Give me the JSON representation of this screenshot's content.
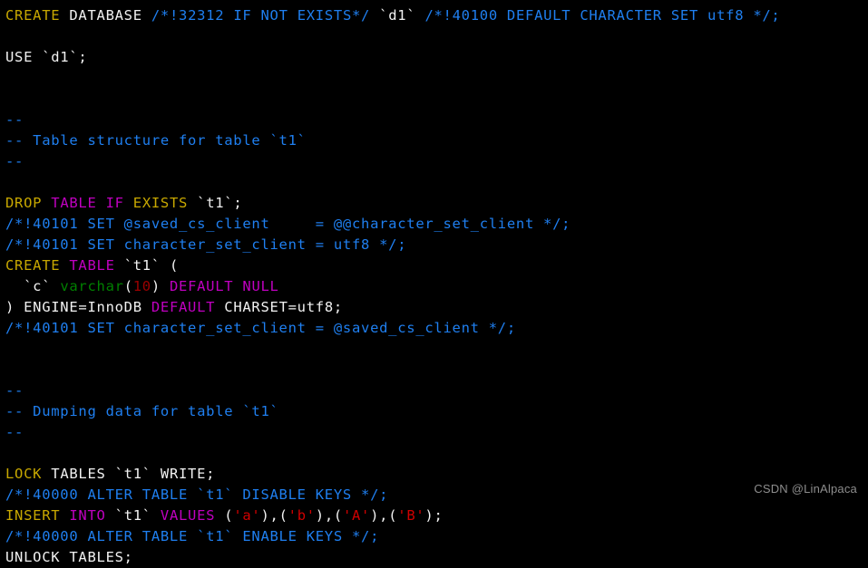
{
  "document": {
    "background_color": "#000000",
    "colors": {
      "keyword_yellow": "#c8a800",
      "keyword_magenta": "#c000c0",
      "plain_text": "#f2f2f2",
      "comment_blue": "#1f7ff0",
      "type_green": "#008000",
      "number_red": "#9c0000",
      "string_red": "#d00000",
      "watermark_gray": "#8d8d8d"
    },
    "lines": [
      {
        "index": 1,
        "text": "CREATE DATABASE /*!32312 IF NOT EXISTS*/ `d1` /*!40100 DEFAULT CHARACTER SET utf8 */;",
        "tokens": [
          {
            "t": "CREATE",
            "c": "kw"
          },
          {
            "t": " ",
            "c": "plain"
          },
          {
            "t": "DATABASE",
            "c": "plain"
          },
          {
            "t": " ",
            "c": "plain"
          },
          {
            "t": "/*!32312 IF NOT EXISTS*/",
            "c": "cmt"
          },
          {
            "t": " ",
            "c": "plain"
          },
          {
            "t": "`d1`",
            "c": "plain"
          },
          {
            "t": " ",
            "c": "plain"
          },
          {
            "t": "/*!40100 DEFAULT CHARACTER SET utf8 */;",
            "c": "cmt"
          }
        ]
      },
      {
        "index": 2,
        "text": "",
        "tokens": []
      },
      {
        "index": 3,
        "text": "USE `d1`;",
        "tokens": [
          {
            "t": "USE `d1`;",
            "c": "plain"
          }
        ]
      },
      {
        "index": 4,
        "text": "",
        "tokens": []
      },
      {
        "index": 5,
        "text": "",
        "tokens": []
      },
      {
        "index": 6,
        "text": "--",
        "tokens": [
          {
            "t": "--",
            "c": "cmt"
          }
        ]
      },
      {
        "index": 7,
        "text": "-- Table structure for table `t1`",
        "tokens": [
          {
            "t": "-- Table structure for table `t1`",
            "c": "cmt"
          }
        ]
      },
      {
        "index": 8,
        "text": "--",
        "tokens": [
          {
            "t": "--",
            "c": "cmt"
          }
        ]
      },
      {
        "index": 9,
        "text": "",
        "tokens": []
      },
      {
        "index": 10,
        "text": "DROP TABLE IF EXISTS `t1`;",
        "tokens": [
          {
            "t": "DROP",
            "c": "kw"
          },
          {
            "t": " ",
            "c": "plain"
          },
          {
            "t": "TABLE",
            "c": "kw2"
          },
          {
            "t": " ",
            "c": "plain"
          },
          {
            "t": "IF",
            "c": "kw2"
          },
          {
            "t": " ",
            "c": "plain"
          },
          {
            "t": "EXISTS",
            "c": "kw"
          },
          {
            "t": " ",
            "c": "plain"
          },
          {
            "t": "`t1`;",
            "c": "plain"
          }
        ]
      },
      {
        "index": 11,
        "text": "/*!40101 SET @saved_cs_client     = @@character_set_client */;",
        "tokens": [
          {
            "t": "/*!40101 SET @saved_cs_client     = @@character_set_client */;",
            "c": "cmt"
          }
        ]
      },
      {
        "index": 12,
        "text": "/*!40101 SET character_set_client = utf8 */;",
        "tokens": [
          {
            "t": "/*!40101 SET character_set_client = utf8 */;",
            "c": "cmt"
          }
        ]
      },
      {
        "index": 13,
        "text": "CREATE TABLE `t1` (",
        "tokens": [
          {
            "t": "CREATE",
            "c": "kw"
          },
          {
            "t": " ",
            "c": "plain"
          },
          {
            "t": "TABLE",
            "c": "kw2"
          },
          {
            "t": " ",
            "c": "plain"
          },
          {
            "t": "`t1` (",
            "c": "plain"
          }
        ]
      },
      {
        "index": 14,
        "text": "  `c` varchar(10) DEFAULT NULL",
        "tokens": [
          {
            "t": "  `c` ",
            "c": "plain"
          },
          {
            "t": "varchar",
            "c": "type"
          },
          {
            "t": "(",
            "c": "plain"
          },
          {
            "t": "10",
            "c": "num"
          },
          {
            "t": ") ",
            "c": "plain"
          },
          {
            "t": "DEFAULT",
            "c": "kw2"
          },
          {
            "t": " ",
            "c": "plain"
          },
          {
            "t": "NULL",
            "c": "kw2"
          }
        ]
      },
      {
        "index": 15,
        "text": ") ENGINE=InnoDB DEFAULT CHARSET=utf8;",
        "tokens": [
          {
            "t": ") ENGINE=InnoDB ",
            "c": "plain"
          },
          {
            "t": "DEFAULT",
            "c": "kw2"
          },
          {
            "t": " CHARSET=utf8;",
            "c": "plain"
          }
        ]
      },
      {
        "index": 16,
        "text": "/*!40101 SET character_set_client = @saved_cs_client */;",
        "tokens": [
          {
            "t": "/*!40101 SET character_set_client = @saved_cs_client */;",
            "c": "cmt"
          }
        ]
      },
      {
        "index": 17,
        "text": "",
        "tokens": []
      },
      {
        "index": 18,
        "text": "",
        "tokens": []
      },
      {
        "index": 19,
        "text": "--",
        "tokens": [
          {
            "t": "--",
            "c": "cmt"
          }
        ]
      },
      {
        "index": 20,
        "text": "-- Dumping data for table `t1`",
        "tokens": [
          {
            "t": "-- Dumping data for table `t1`",
            "c": "cmt"
          }
        ]
      },
      {
        "index": 21,
        "text": "--",
        "tokens": [
          {
            "t": "--",
            "c": "cmt"
          }
        ]
      },
      {
        "index": 22,
        "text": "",
        "tokens": []
      },
      {
        "index": 23,
        "text": "LOCK TABLES `t1` WRITE;",
        "tokens": [
          {
            "t": "LOCK",
            "c": "kw"
          },
          {
            "t": " TABLES `t1` WRITE;",
            "c": "plain"
          }
        ]
      },
      {
        "index": 24,
        "text": "/*!40000 ALTER TABLE `t1` DISABLE KEYS */;",
        "tokens": [
          {
            "t": "/*!40000 ALTER TABLE `t1` DISABLE KEYS */;",
            "c": "cmt"
          }
        ]
      },
      {
        "index": 25,
        "text": "INSERT INTO `t1` VALUES ('a'),('b'),('A'),('B');",
        "tokens": [
          {
            "t": "INSERT",
            "c": "kw"
          },
          {
            "t": " ",
            "c": "plain"
          },
          {
            "t": "INTO",
            "c": "kw2"
          },
          {
            "t": " `t1` ",
            "c": "plain"
          },
          {
            "t": "VALUES",
            "c": "kw2"
          },
          {
            "t": " (",
            "c": "plain"
          },
          {
            "t": "'a'",
            "c": "str"
          },
          {
            "t": "),(",
            "c": "plain"
          },
          {
            "t": "'b'",
            "c": "str"
          },
          {
            "t": "),(",
            "c": "plain"
          },
          {
            "t": "'A'",
            "c": "str"
          },
          {
            "t": "),(",
            "c": "plain"
          },
          {
            "t": "'B'",
            "c": "str"
          },
          {
            "t": ");",
            "c": "plain"
          }
        ]
      },
      {
        "index": 26,
        "text": "/*!40000 ALTER TABLE `t1` ENABLE KEYS */;",
        "tokens": [
          {
            "t": "/*!40000 ALTER TABLE `t1` ENABLE KEYS */;",
            "c": "cmt"
          }
        ]
      },
      {
        "index": 27,
        "text": "UNLOCK TABLES;",
        "tokens": [
          {
            "t": "UNLOCK TABLES;",
            "c": "plain"
          }
        ]
      }
    ]
  },
  "watermark": {
    "label": "CSDN @LinAlpaca"
  }
}
